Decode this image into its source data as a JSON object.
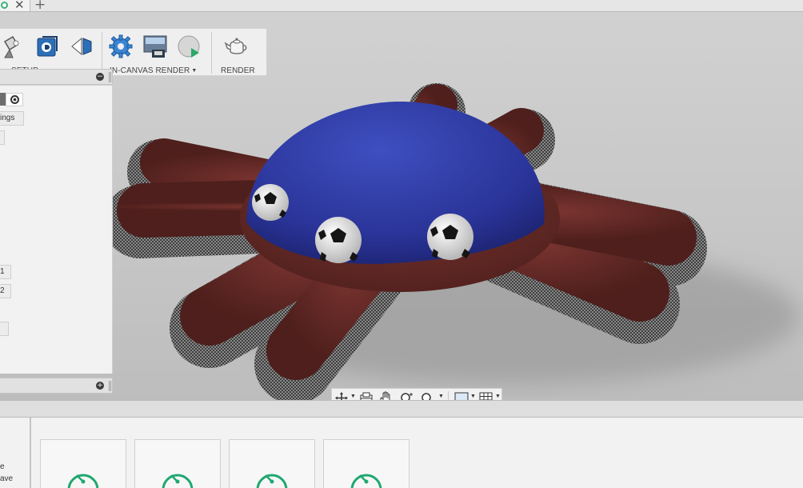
{
  "toolbar": {
    "setup_label": "SETUP",
    "in_canvas_render_label": "IN-CANVAS RENDER",
    "render_label": "RENDER"
  },
  "browser_panel": {
    "settings_field": "ings",
    "value_1": "1",
    "value_2": "2"
  },
  "gallery": {
    "side_text_1": "e",
    "side_text_2": "ave",
    "cards": [
      {
        "status": "rendering"
      },
      {
        "status": "rendering"
      },
      {
        "status": "rendering"
      },
      {
        "status": "rendering"
      }
    ]
  },
  "icons": {
    "tab_status": "circle-icon",
    "tab_close": "close-icon",
    "tab_new": "plus-icon",
    "setup": "spotlight-icon",
    "scene_settings": "scene-settings-icon",
    "decal": "decal-icon",
    "settings": "gear-icon",
    "capture": "capture-image-icon",
    "in_canvas_render": "play-render-icon",
    "render": "teapot-icon",
    "orbit": "orbit-icon",
    "look_at": "look-at-icon",
    "pan": "hand-pan-icon",
    "zoom": "zoom-icon",
    "fit": "zoom-window-icon",
    "display": "display-settings-icon",
    "grid": "grid-icon",
    "progress": "timer-gauge-icon"
  },
  "colors": {
    "accent_blue": "#2f78c4",
    "progress_green": "#1fa870",
    "dome_blue": "#2f3da8",
    "leather_brown": "#6b2c28"
  }
}
